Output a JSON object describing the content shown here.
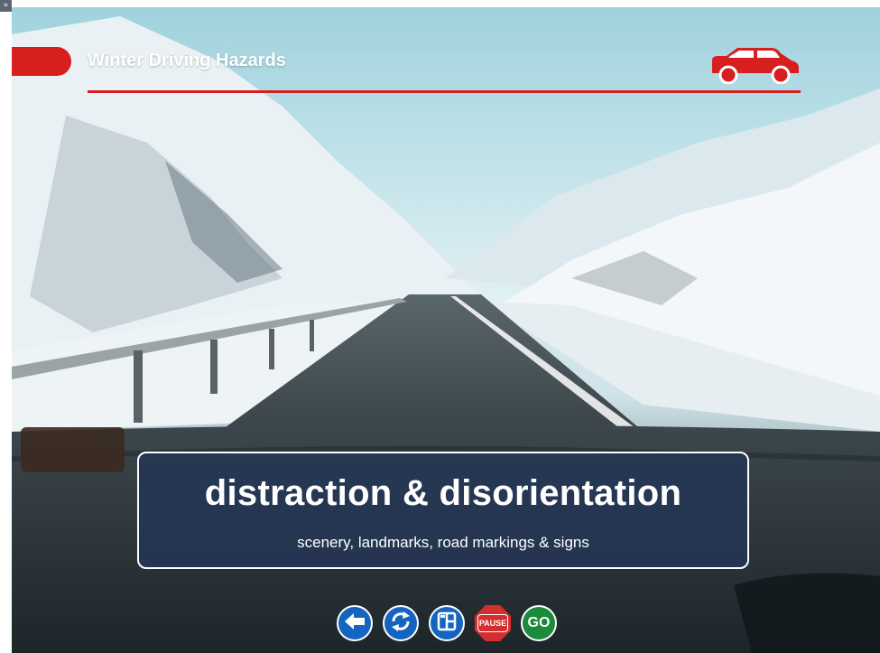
{
  "sidebar_toggle": {
    "glyph": "»"
  },
  "header": {
    "title": "Winter Driving Hazards",
    "accent_color": "#d71f1f",
    "icon": "car-icon"
  },
  "caption": {
    "heading": "distraction & disorientation",
    "subheading": "scenery, landmarks, road markings & signs"
  },
  "controls": [
    {
      "name": "back",
      "icon": "arrow-left-icon",
      "label": ""
    },
    {
      "name": "replay",
      "icon": "replay-icon",
      "label": ""
    },
    {
      "name": "menu",
      "icon": "grid-menu-icon",
      "label": ""
    },
    {
      "name": "pause",
      "icon": "pause-sign-icon",
      "label": "PAUSE"
    },
    {
      "name": "go",
      "icon": "go-sign-icon",
      "label": "GO"
    }
  ]
}
